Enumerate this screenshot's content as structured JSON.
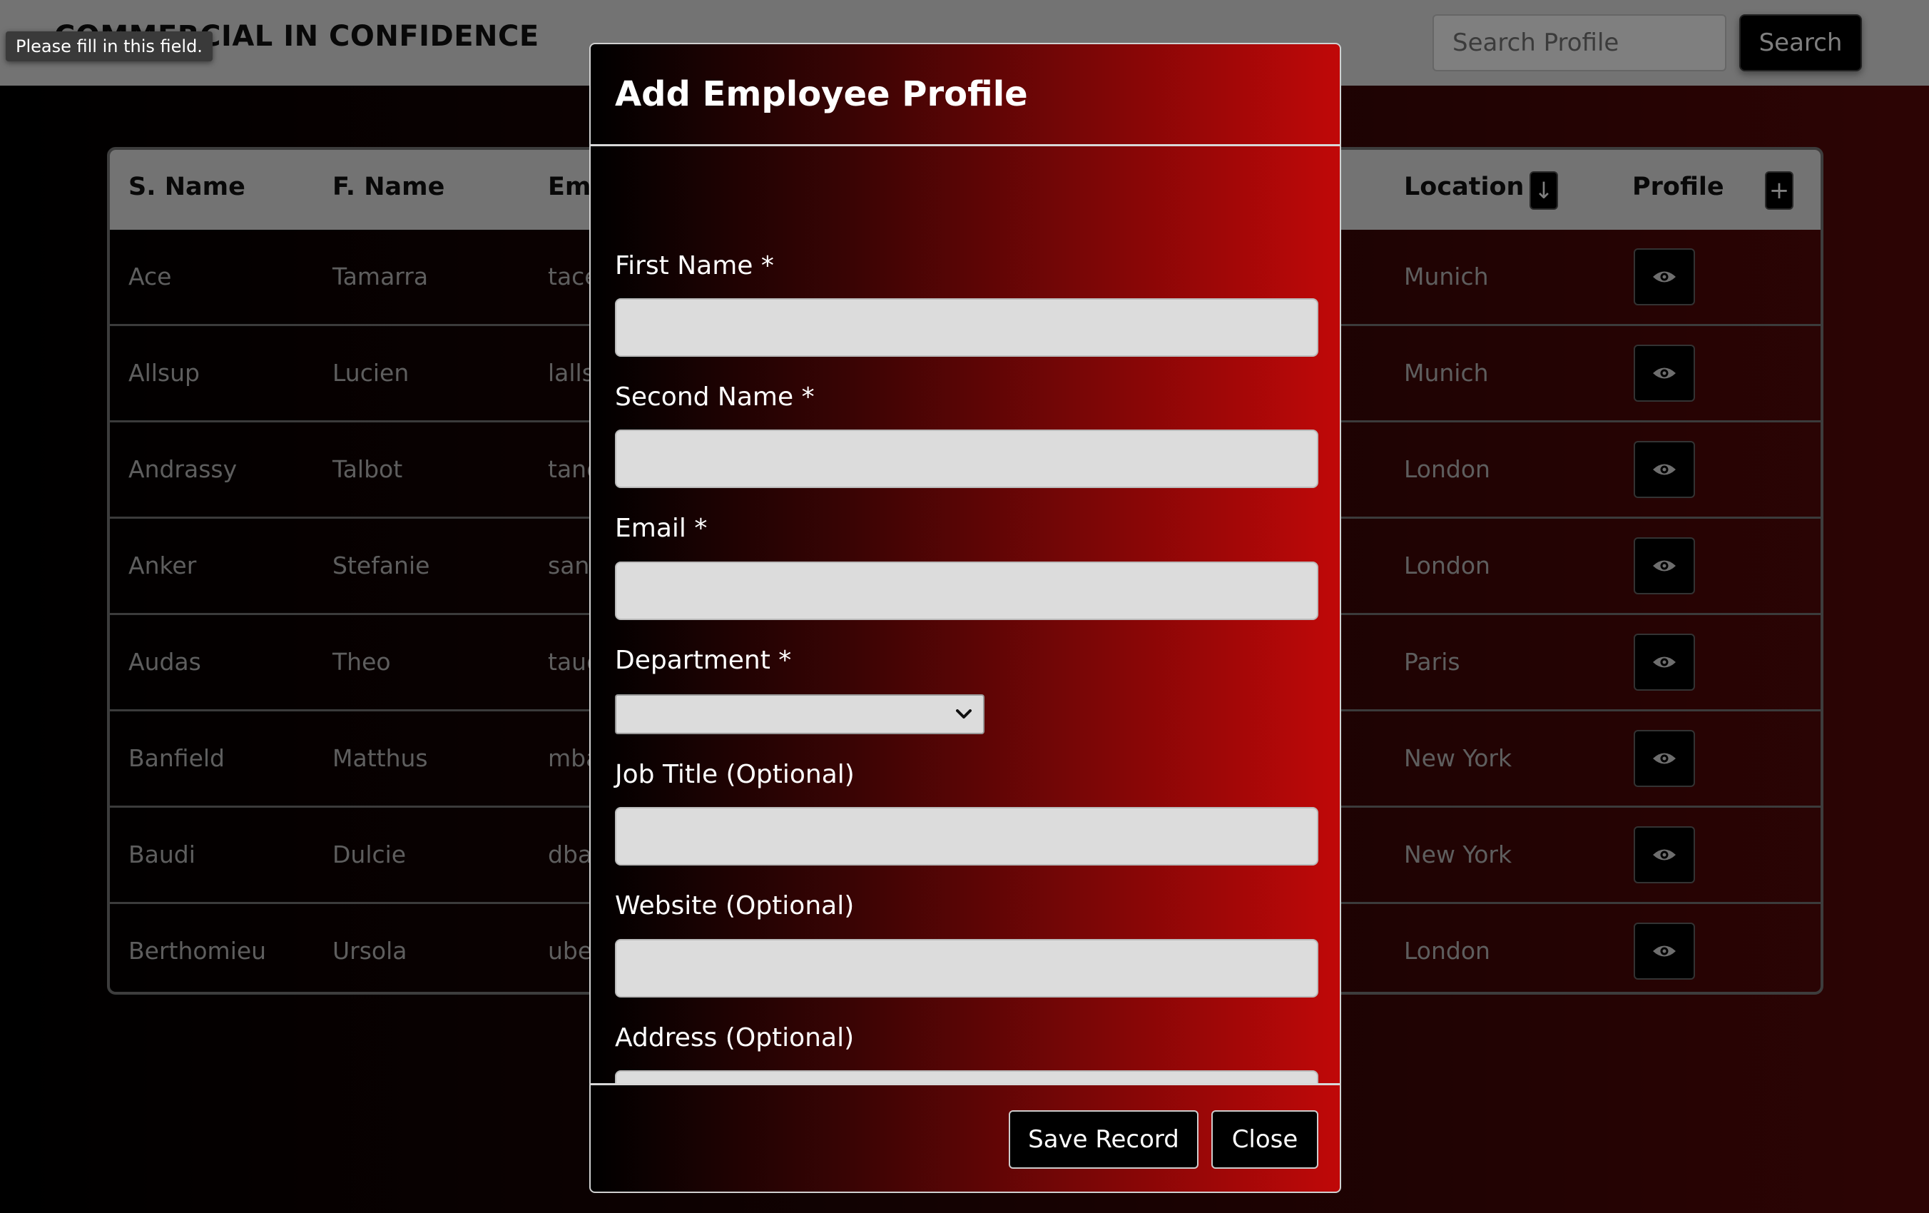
{
  "header": {
    "brand": "COMMERCIAL IN CONFIDENCE",
    "search_placeholder": "Search Profile",
    "search_button": "Search"
  },
  "table": {
    "columns": {
      "surname": "S. Name",
      "firstname": "F. Name",
      "email": "Em",
      "location": "Location",
      "profile": "Profile"
    },
    "sort_icon": "arrow-down-icon",
    "add_icon": "plus-icon",
    "rows": [
      {
        "surname": "Ace",
        "firstname": "Tamarra",
        "email": "tace",
        "location": "Munich"
      },
      {
        "surname": "Allsup",
        "firstname": "Lucien",
        "email": "lalls",
        "location": "Munich"
      },
      {
        "surname": "Andrassy",
        "firstname": "Talbot",
        "email": "tand",
        "location": "London"
      },
      {
        "surname": "Anker",
        "firstname": "Stefanie",
        "email": "sank",
        "location": "London"
      },
      {
        "surname": "Audas",
        "firstname": "Theo",
        "email": "taud",
        "location": "Paris"
      },
      {
        "surname": "Banfield",
        "firstname": "Matthus",
        "email": "mba",
        "location": "New York"
      },
      {
        "surname": "Baudi",
        "firstname": "Dulcie",
        "email": "dba",
        "location": "New York"
      },
      {
        "surname": "Berthomieu",
        "firstname": "Ursola",
        "email": "ube",
        "location": "London"
      }
    ]
  },
  "tooltip": "Please fill in this field.",
  "modal": {
    "title": "Add Employee Profile",
    "fields": {
      "first_name": "First Name *",
      "second_name": "Second Name *",
      "email": "Email *",
      "department": "Department *",
      "job_title": "Job Title (Optional)",
      "website": "Website (Optional)",
      "address": "Address (Optional)"
    },
    "department_value": "",
    "save_button": "Save Record",
    "close_button": "Close"
  },
  "colors": {
    "modal_gradient_end": "#c00808",
    "page_gradient_end": "#5a0808",
    "header_bg": "#e6e6e6"
  }
}
